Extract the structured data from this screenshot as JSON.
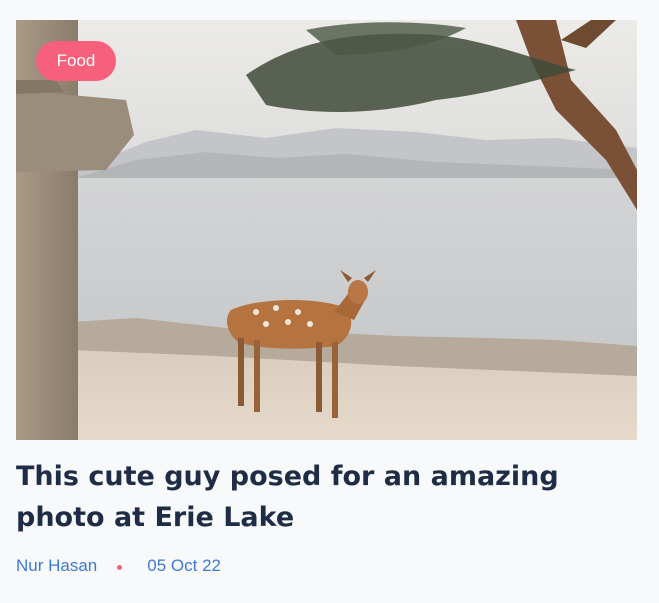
{
  "post": {
    "category": "Food",
    "title": "This cute guy posed for an amazing photo at Erie Lake",
    "author": "Nur Hasan",
    "date": "05 Oct 22"
  },
  "icons": {
    "separator": "dot-icon"
  },
  "colors": {
    "badge_bg": "#f7607a",
    "title": "#1e2d45",
    "meta_link": "#3d79d6",
    "separator_dot": "#f7607a",
    "page_bg": "#f8f9fb"
  }
}
